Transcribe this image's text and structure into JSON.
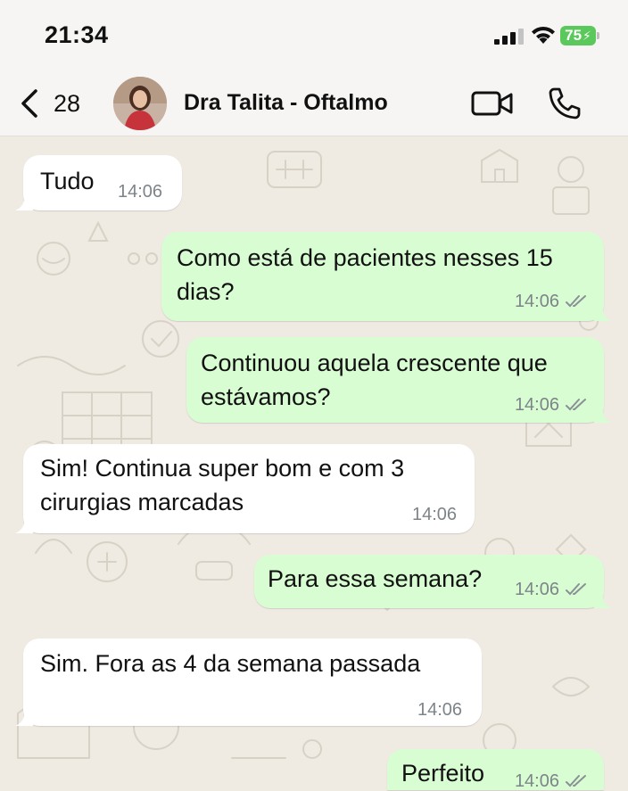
{
  "status_bar": {
    "time": "21:34",
    "battery": "75"
  },
  "header": {
    "unread_count": "28",
    "contact_name": "Dra Talita - Oftalmo"
  },
  "messages": [
    {
      "direction": "incoming",
      "lines": [
        "Tudo"
      ],
      "time": "14:06"
    },
    {
      "direction": "outgoing",
      "lines": [
        "Como está de pacientes nesses 15",
        "dias?"
      ],
      "time": "14:06",
      "status": "read"
    },
    {
      "direction": "outgoing",
      "lines": [
        "Continuou aquela crescente que",
        "estávamos?"
      ],
      "time": "14:06",
      "status": "read"
    },
    {
      "direction": "incoming",
      "lines": [
        "Sim! Continua super bom e com 3",
        "cirurgias marcadas"
      ],
      "time": "14:06"
    },
    {
      "direction": "outgoing",
      "lines": [
        "Para essa semana?"
      ],
      "time": "14:06",
      "status": "read"
    },
    {
      "direction": "incoming",
      "lines": [
        "Sim. Fora as 4 da semana passada"
      ],
      "time": "14:06"
    },
    {
      "direction": "outgoing",
      "lines": [
        "Perfeito"
      ],
      "time": "14:06",
      "status": "read"
    }
  ],
  "colors": {
    "incoming_bubble": "#ffffff",
    "outgoing_bubble": "#d9fdd3",
    "wallpaper": "#efeae2",
    "read_ticks": "#8a9196"
  },
  "icons": [
    "back-chevron-icon",
    "video-call-icon",
    "voice-call-icon",
    "signal-icon",
    "wifi-icon",
    "battery-icon",
    "read-ticks-icon"
  ]
}
